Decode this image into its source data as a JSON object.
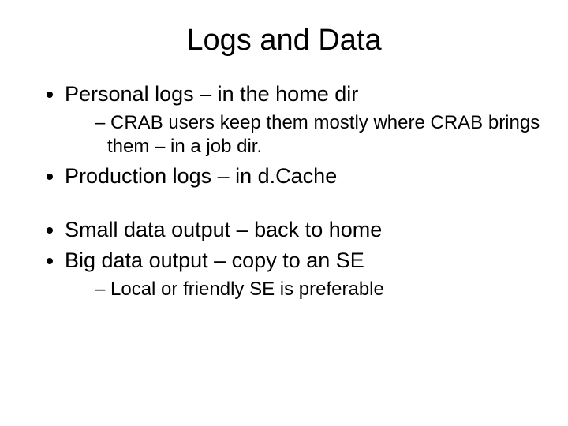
{
  "title": "Logs and Data",
  "bullets": {
    "b1": "Personal logs – in the home dir",
    "b1_sub1": "CRAB users keep them mostly where CRAB brings them – in a job dir.",
    "b2": "Production logs – in d.Cache",
    "b3": "Small data output – back to home",
    "b4": "Big data output – copy to an SE",
    "b4_sub1": "Local or friendly SE is preferable"
  }
}
